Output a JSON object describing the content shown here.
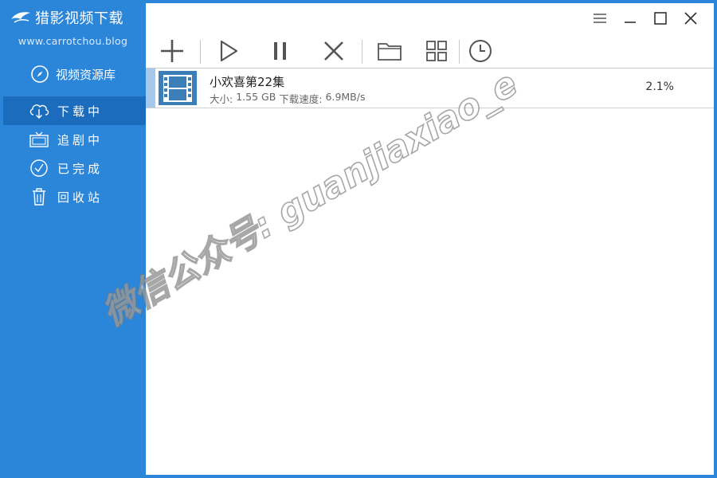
{
  "app": {
    "title": "猎影视频下载",
    "site": "www.carrotchou.blog"
  },
  "sidebar": {
    "library_label": "视频资源库",
    "items": [
      {
        "label": "下载中",
        "icon": "cloud-download-icon",
        "active": true
      },
      {
        "label": "追剧中",
        "icon": "tv-icon",
        "active": false
      },
      {
        "label": "已完成",
        "icon": "check-circle-icon",
        "active": false
      },
      {
        "label": "回收站",
        "icon": "trash-icon",
        "active": false
      }
    ]
  },
  "toolbar": {
    "buttons": [
      "add-icon",
      "play-icon",
      "pause-icon",
      "delete-icon",
      "folder-icon",
      "grid-icon",
      "clock-icon"
    ]
  },
  "downloads": [
    {
      "name": "小欢喜第22集",
      "size_label": "大小:",
      "size": "1.55 GB",
      "speed_label": "下载速度:",
      "speed": "6.9MB/s",
      "progress": "2.1%"
    }
  ],
  "watermark": "微信公众号: guanjiaxiao_e",
  "colors": {
    "sidebar": "#2b86d9",
    "active": "#1b6cbd",
    "thumb": "#3c7fb8"
  }
}
